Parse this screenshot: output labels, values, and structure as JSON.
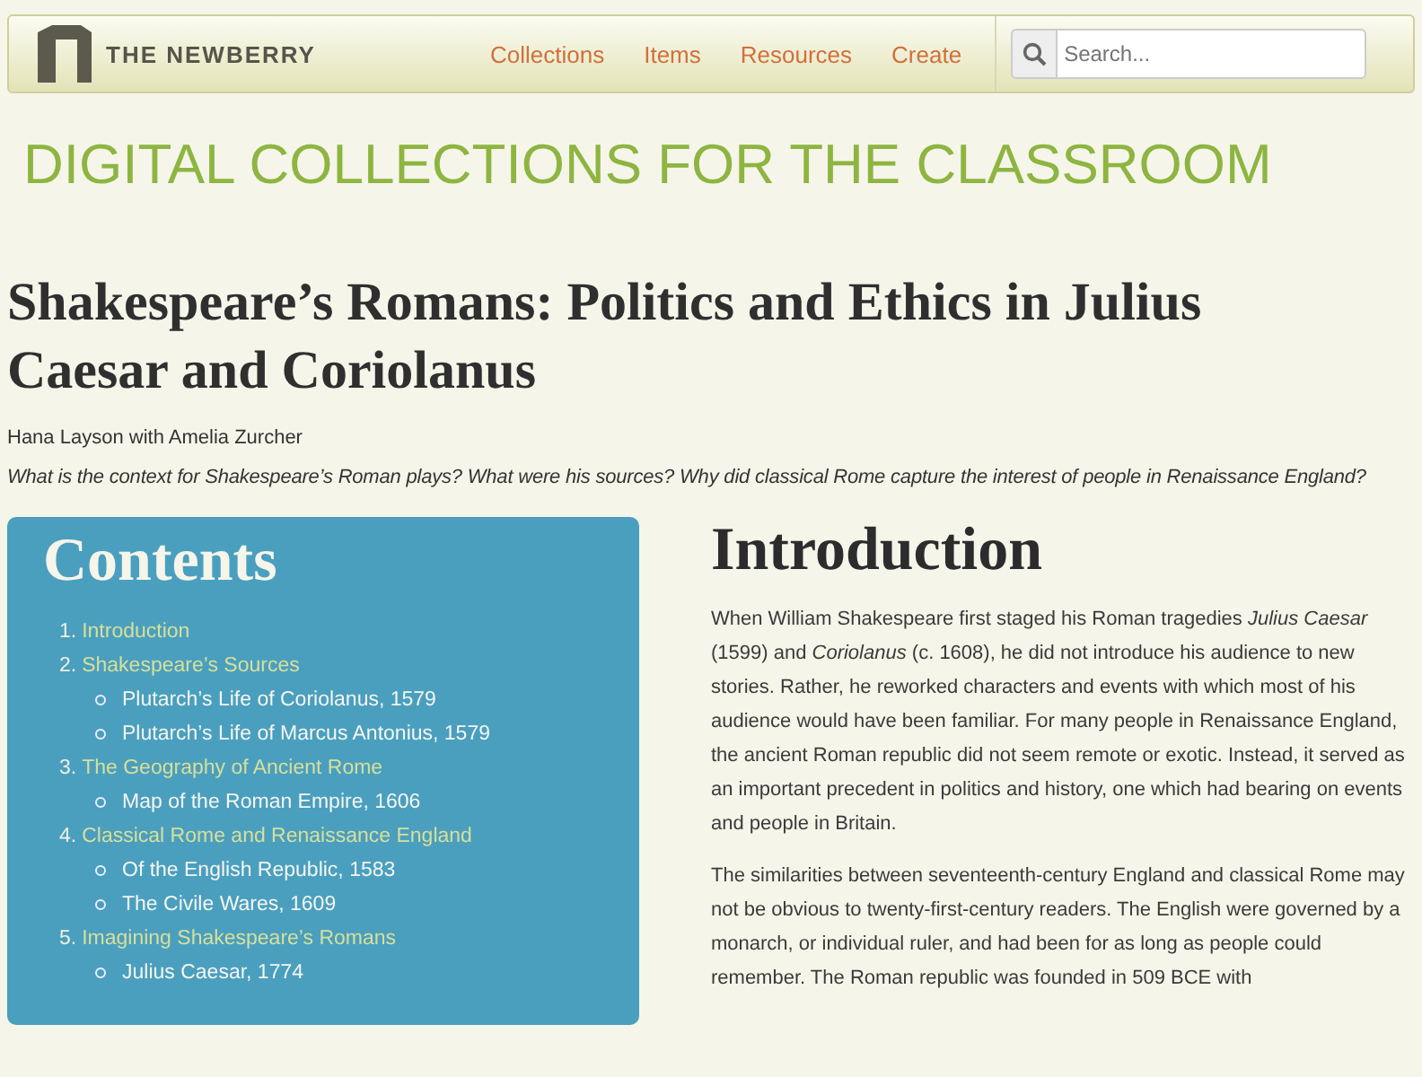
{
  "header": {
    "logo_text": "THE NEWBERRY",
    "nav": [
      {
        "label": "Collections"
      },
      {
        "label": "Items"
      },
      {
        "label": "Resources"
      },
      {
        "label": "Create"
      }
    ],
    "search": {
      "placeholder": "Search..."
    }
  },
  "site_title": "DIGITAL COLLECTIONS FOR THE CLASSROOM",
  "page_title": "Shakespeare’s Romans: Politics and Ethics in Julius Caesar and Coriolanus",
  "authors": "Hana Layson with Amelia Zurcher",
  "lead": "What is the context for Shakespeare’s Roman plays? What were his sources? Why did classical Rome capture the interest of people in Renaissance England?",
  "contents": {
    "title": "Contents",
    "items": [
      {
        "number": "1.",
        "label": "Introduction"
      },
      {
        "number": "2.",
        "label": "Shakespeare’s Sources",
        "children": [
          "Plutarch’s Life of Coriolanus, 1579",
          "Plutarch’s Life of Marcus Antonius, 1579"
        ]
      },
      {
        "number": "3.",
        "label": "The Geography of Ancient Rome",
        "children": [
          "Map of the Roman Empire, 1606"
        ]
      },
      {
        "number": "4.",
        "label": "Classical Rome and Renaissance England",
        "children": [
          "Of the English Republic, 1583",
          "The Civile Wares, 1609"
        ]
      },
      {
        "number": "5.",
        "label": "Imagining Shakespeare’s Romans",
        "children": [
          "Julius Caesar, 1774"
        ]
      }
    ]
  },
  "article": {
    "heading": "Introduction",
    "paragraphs": [
      "When William Shakespeare first staged his Roman tragedies *Julius Caesar* (1599) and *Coriolanus* (c. 1608), he did not introduce his audience to new stories. Rather, he reworked characters and events with which most of his audience would have been familiar. For many people in Renaissance England, the ancient Roman republic did not seem remote or exotic. Instead, it served as an important precedent in politics and history, one which had bearing on events and people in Britain.",
      "The similarities between seventeenth-century England and classical Rome may not be obvious to twenty-first-century readers. The English were governed by a monarch, or individual ruler, and had been for as long as people could remember. The Roman republic was founded in 509 BCE with"
    ]
  }
}
